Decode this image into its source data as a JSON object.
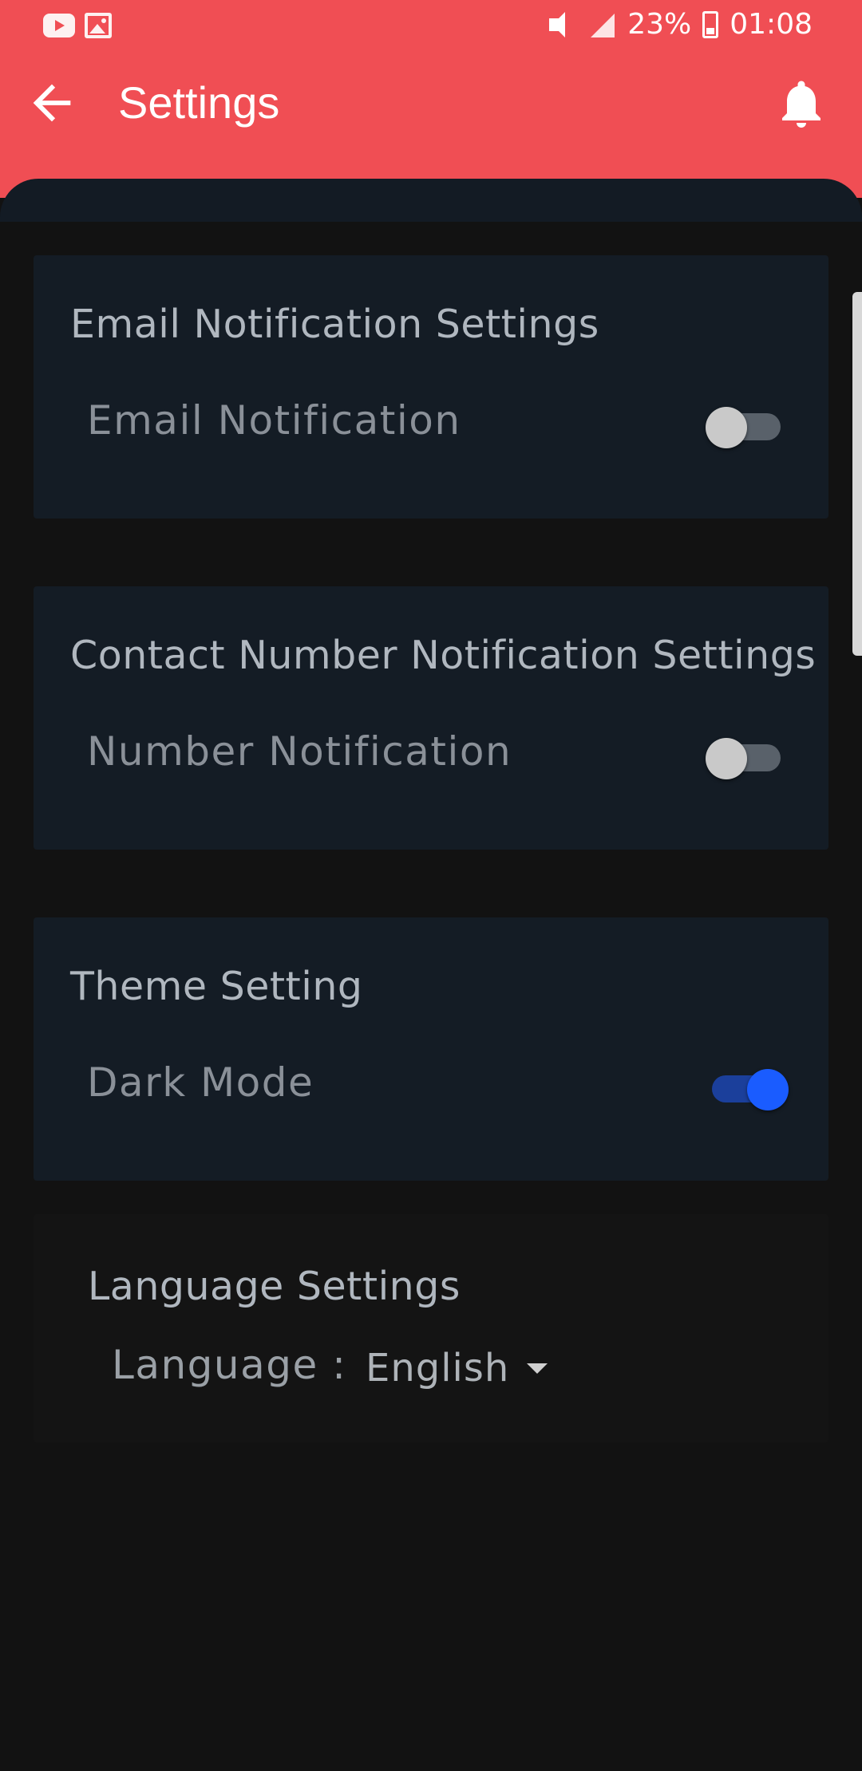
{
  "status_bar": {
    "battery": "23%",
    "time": "01:08",
    "left_icons": [
      "youtube-icon",
      "image-icon"
    ],
    "right_icons": [
      "mute-icon",
      "signal-icon",
      "battery-icon"
    ]
  },
  "app_bar": {
    "title": "Settings",
    "background": "#f04e54",
    "back_icon": "arrow-left-icon",
    "action_icon": "bell-icon"
  },
  "sections": {
    "email": {
      "title": "Email Notification Settings",
      "toggle_label": "Email Notification",
      "enabled": false
    },
    "number": {
      "title": "Contact Number Notification Settings",
      "toggle_label": "Number Notification",
      "enabled": false
    },
    "theme": {
      "title": "Theme Setting",
      "toggle_label": "Dark Mode",
      "enabled": true
    },
    "language": {
      "title": "Language Settings",
      "label": "Language :",
      "selected": "English"
    }
  },
  "colors": {
    "accent": "#f04e54",
    "card": "#141c25",
    "switch_on": "#1a5cff"
  }
}
